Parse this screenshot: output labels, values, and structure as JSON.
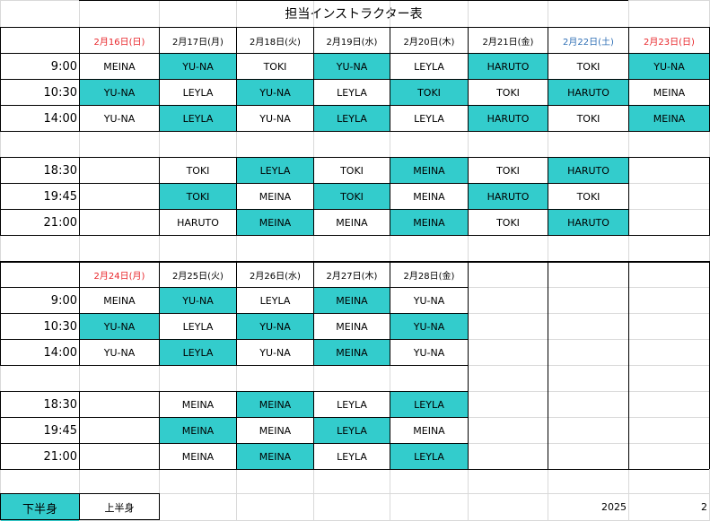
{
  "title": "担当インストラクター表",
  "week1": {
    "headers": [
      {
        "label": "2月16日(日)",
        "color": "red"
      },
      {
        "label": "2月17日(月)",
        "color": "black"
      },
      {
        "label": "2月18日(火)",
        "color": "black"
      },
      {
        "label": "2月19日(水)",
        "color": "black"
      },
      {
        "label": "2月20日(木)",
        "color": "black"
      },
      {
        "label": "2月21日(金)",
        "color": "black"
      },
      {
        "label": "2月22日(土)",
        "color": "blue"
      },
      {
        "label": "2月23日(日)",
        "color": "red"
      }
    ],
    "morning": [
      {
        "time": "9:00",
        "cells": [
          {
            "v": "MEINA",
            "hl": false
          },
          {
            "v": "YU-NA",
            "hl": true
          },
          {
            "v": "TOKI",
            "hl": false
          },
          {
            "v": "YU-NA",
            "hl": true
          },
          {
            "v": "LEYLA",
            "hl": false
          },
          {
            "v": "HARUTO",
            "hl": true
          },
          {
            "v": "TOKI",
            "hl": false
          },
          {
            "v": "YU-NA",
            "hl": true
          }
        ]
      },
      {
        "time": "10:30",
        "cells": [
          {
            "v": "YU-NA",
            "hl": true
          },
          {
            "v": "LEYLA",
            "hl": false
          },
          {
            "v": "YU-NA",
            "hl": true
          },
          {
            "v": "LEYLA",
            "hl": false
          },
          {
            "v": "TOKI",
            "hl": true
          },
          {
            "v": "TOKI",
            "hl": false
          },
          {
            "v": "HARUTO",
            "hl": true
          },
          {
            "v": "MEINA",
            "hl": false
          }
        ]
      },
      {
        "time": "14:00",
        "cells": [
          {
            "v": "YU-NA",
            "hl": false
          },
          {
            "v": "LEYLA",
            "hl": true
          },
          {
            "v": "YU-NA",
            "hl": false
          },
          {
            "v": "LEYLA",
            "hl": true
          },
          {
            "v": "LEYLA",
            "hl": false
          },
          {
            "v": "HARUTO",
            "hl": true
          },
          {
            "v": "TOKI",
            "hl": false
          },
          {
            "v": "MEINA",
            "hl": true
          }
        ]
      }
    ],
    "evening": [
      {
        "time": "18:30",
        "cells": [
          {
            "v": "TOKI",
            "hl": false
          },
          {
            "v": "LEYLA",
            "hl": true
          },
          {
            "v": "TOKI",
            "hl": false
          },
          {
            "v": "MEINA",
            "hl": true
          },
          {
            "v": "TOKI",
            "hl": false
          },
          {
            "v": "HARUTO",
            "hl": true
          }
        ]
      },
      {
        "time": "19:45",
        "cells": [
          {
            "v": "TOKI",
            "hl": true
          },
          {
            "v": "MEINA",
            "hl": false
          },
          {
            "v": "TOKI",
            "hl": true
          },
          {
            "v": "MEINA",
            "hl": false
          },
          {
            "v": "HARUTO",
            "hl": true
          },
          {
            "v": "TOKI",
            "hl": false
          }
        ]
      },
      {
        "time": "21:00",
        "cells": [
          {
            "v": "HARUTO",
            "hl": false
          },
          {
            "v": "MEINA",
            "hl": true
          },
          {
            "v": "MEINA",
            "hl": false
          },
          {
            "v": "MEINA",
            "hl": true
          },
          {
            "v": "TOKI",
            "hl": false
          },
          {
            "v": "HARUTO",
            "hl": true
          }
        ]
      }
    ]
  },
  "week2": {
    "headers": [
      {
        "label": "2月24日(月)",
        "color": "red"
      },
      {
        "label": "2月25日(火)",
        "color": "black"
      },
      {
        "label": "2月26日(水)",
        "color": "black"
      },
      {
        "label": "2月27日(木)",
        "color": "black"
      },
      {
        "label": "2月28日(金)",
        "color": "black"
      }
    ],
    "morning": [
      {
        "time": "9:00",
        "cells": [
          {
            "v": "MEINA",
            "hl": false
          },
          {
            "v": "YU-NA",
            "hl": true
          },
          {
            "v": "LEYLA",
            "hl": false
          },
          {
            "v": "MEINA",
            "hl": true
          },
          {
            "v": "YU-NA",
            "hl": false
          }
        ]
      },
      {
        "time": "10:30",
        "cells": [
          {
            "v": "YU-NA",
            "hl": true
          },
          {
            "v": "LEYLA",
            "hl": false
          },
          {
            "v": "YU-NA",
            "hl": true
          },
          {
            "v": "MEINA",
            "hl": false
          },
          {
            "v": "YU-NA",
            "hl": true
          }
        ]
      },
      {
        "time": "14:00",
        "cells": [
          {
            "v": "YU-NA",
            "hl": false
          },
          {
            "v": "LEYLA",
            "hl": true
          },
          {
            "v": "YU-NA",
            "hl": false
          },
          {
            "v": "MEINA",
            "hl": true
          },
          {
            "v": "YU-NA",
            "hl": false
          }
        ]
      }
    ],
    "evening": [
      {
        "time": "18:30",
        "cells": [
          {
            "v": "MEINA",
            "hl": false
          },
          {
            "v": "MEINA",
            "hl": true
          },
          {
            "v": "LEYLA",
            "hl": false
          },
          {
            "v": "LEYLA",
            "hl": true
          }
        ]
      },
      {
        "time": "19:45",
        "cells": [
          {
            "v": "MEINA",
            "hl": true
          },
          {
            "v": "MEINA",
            "hl": false
          },
          {
            "v": "LEYLA",
            "hl": true
          },
          {
            "v": "MEINA",
            "hl": false
          }
        ]
      },
      {
        "time": "21:00",
        "cells": [
          {
            "v": "MEINA",
            "hl": false
          },
          {
            "v": "MEINA",
            "hl": true
          },
          {
            "v": "LEYLA",
            "hl": false
          },
          {
            "v": "LEYLA",
            "hl": true
          }
        ]
      }
    ]
  },
  "footer": {
    "button_lower": "下半身",
    "button_upper": "上半身",
    "year": "2025",
    "month": "2"
  },
  "colors": {
    "highlight": "#33cccc",
    "sunday_red": "#e8252a",
    "saturday_blue": "#2f6fb5"
  }
}
